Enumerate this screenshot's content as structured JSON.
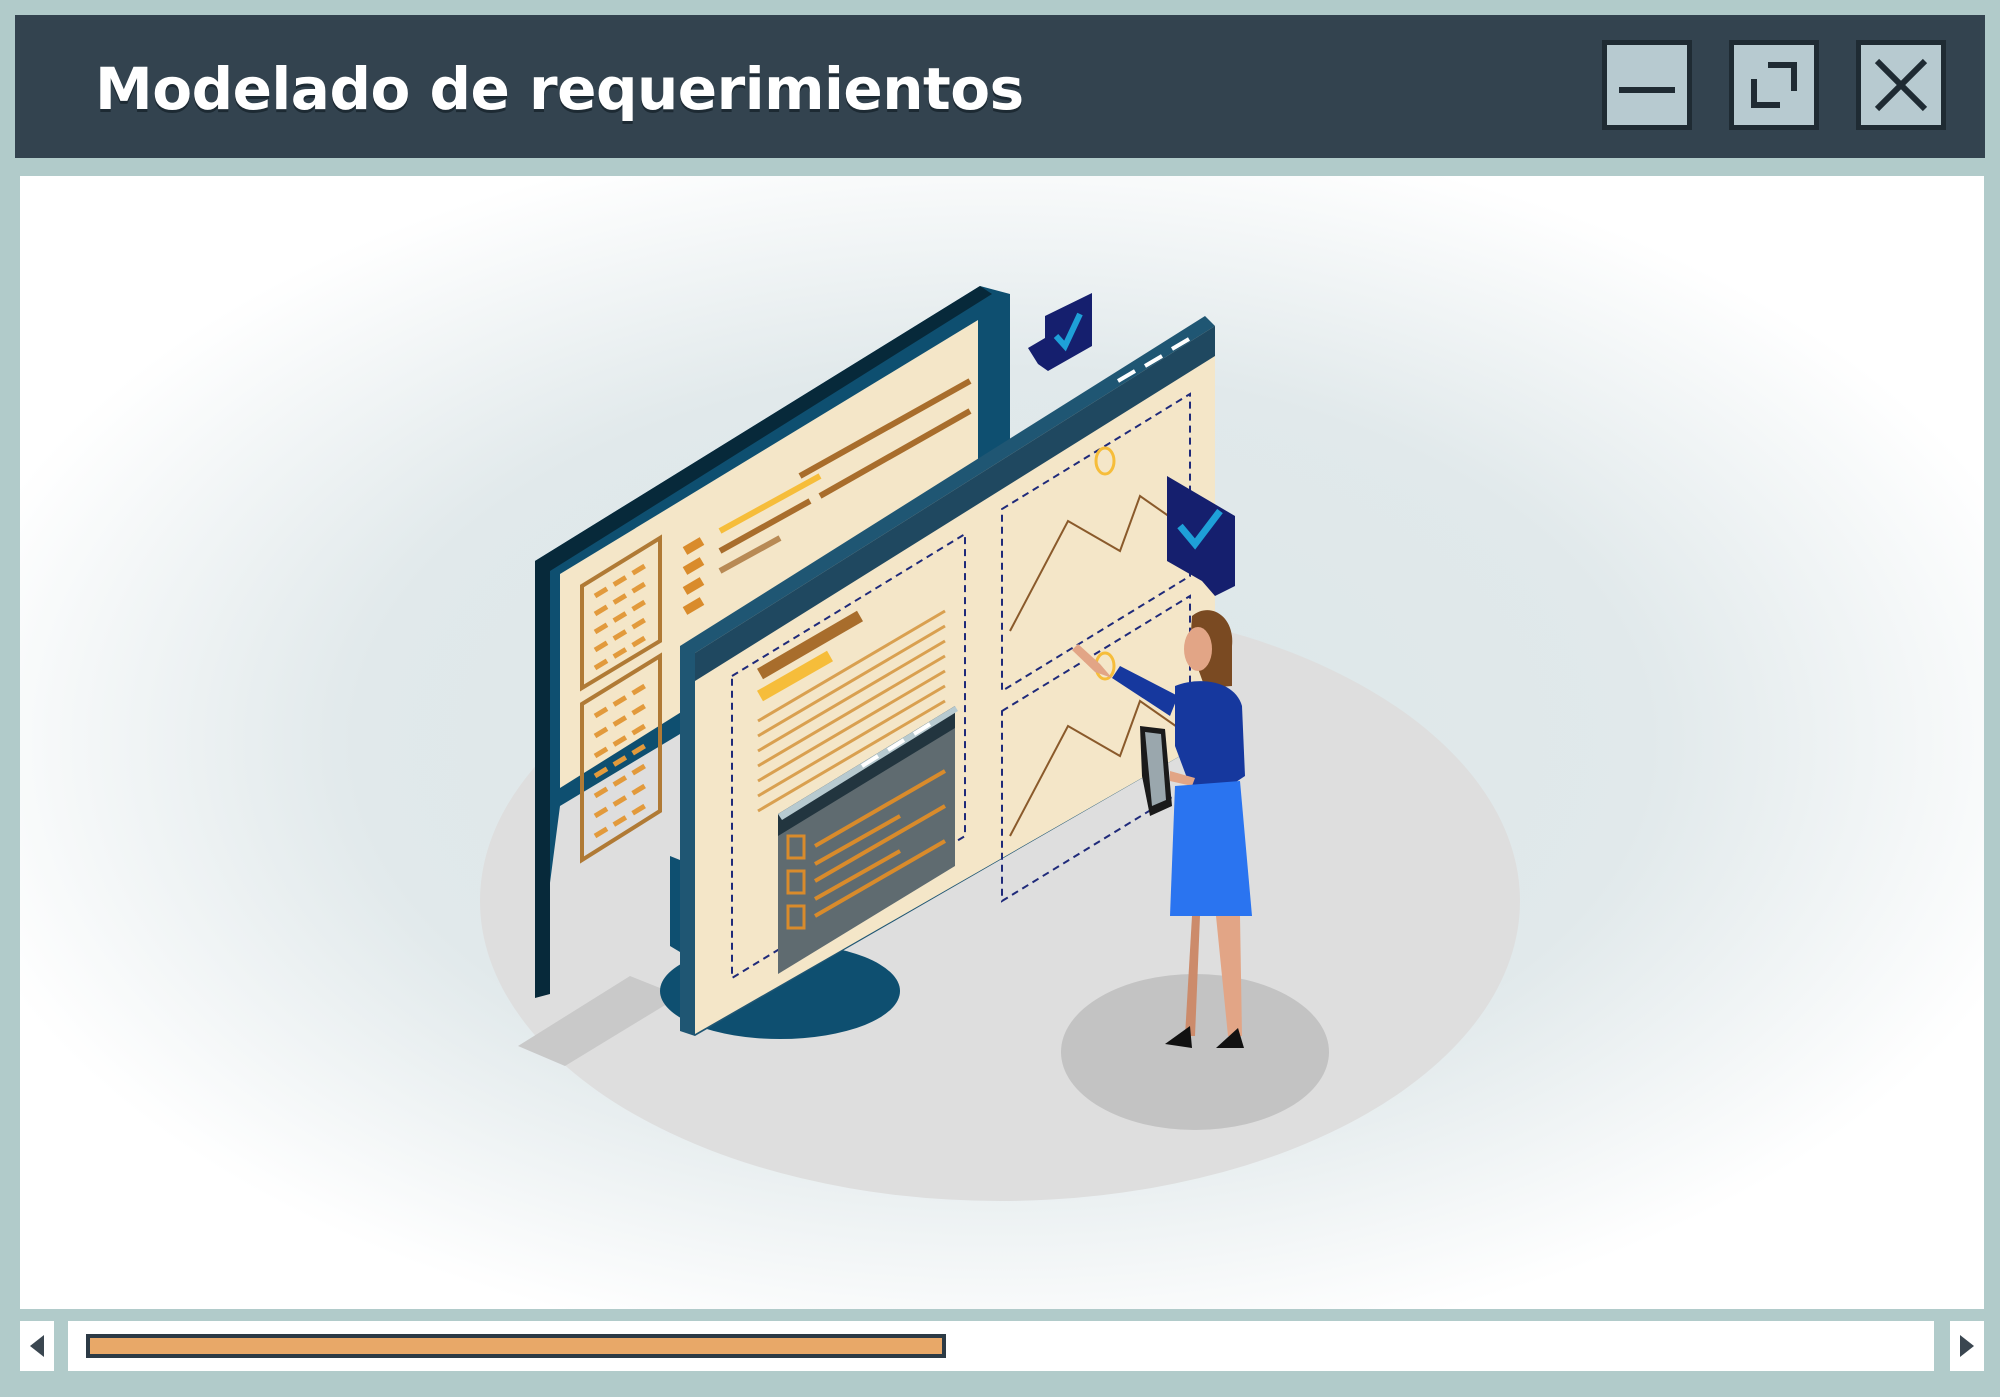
{
  "window": {
    "title": "Modelado de requerimientos",
    "controls": {
      "minimize": "minimize-icon",
      "restore": "restore-icon",
      "close": "close-icon"
    }
  },
  "scrollbar": {
    "left_arrow": "arrow-left-icon",
    "right_arrow": "arrow-right-icon",
    "visible_fraction": 0.46
  },
  "colors": {
    "titlebar": "#33434f",
    "frame": "#b1cbca",
    "thumb": "#e8a868",
    "accent_blue": "#2a74f0",
    "check_badge": "#151f6e"
  }
}
